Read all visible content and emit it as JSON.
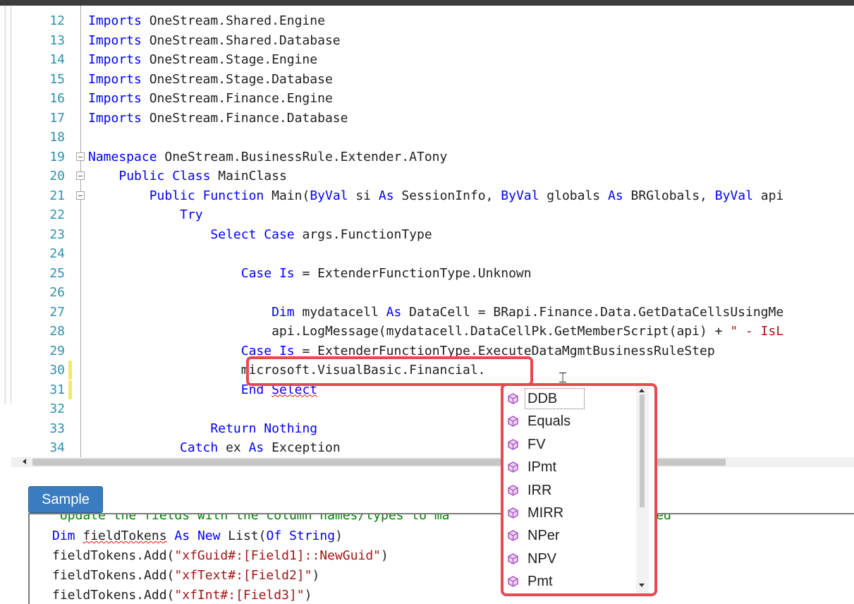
{
  "editor": {
    "lines": [
      {
        "num": "12",
        "tokens": [
          {
            "t": "Imports",
            "k": "kw"
          },
          {
            "t": " OneStream.Shared.Engine"
          }
        ]
      },
      {
        "num": "13",
        "tokens": [
          {
            "t": "Imports",
            "k": "kw"
          },
          {
            "t": " OneStream.Shared.Database"
          }
        ]
      },
      {
        "num": "14",
        "tokens": [
          {
            "t": "Imports",
            "k": "kw"
          },
          {
            "t": " OneStream.Stage.Engine"
          }
        ]
      },
      {
        "num": "15",
        "tokens": [
          {
            "t": "Imports",
            "k": "kw"
          },
          {
            "t": " OneStream.Stage.Database"
          }
        ]
      },
      {
        "num": "16",
        "tokens": [
          {
            "t": "Imports",
            "k": "kw"
          },
          {
            "t": " OneStream.Finance.Engine"
          }
        ]
      },
      {
        "num": "17",
        "tokens": [
          {
            "t": "Imports",
            "k": "kw"
          },
          {
            "t": " OneStream.Finance.Database"
          }
        ]
      },
      {
        "num": "18",
        "tokens": []
      },
      {
        "num": "19",
        "fold": true,
        "tokens": [
          {
            "t": "Namespace",
            "k": "kw"
          },
          {
            "t": " OneStream.BusinessRule.Extender.ATony"
          }
        ]
      },
      {
        "num": "20",
        "fold": true,
        "tokens": [
          {
            "t": "    "
          },
          {
            "t": "Public",
            "k": "kw"
          },
          {
            "t": " "
          },
          {
            "t": "Class",
            "k": "kw"
          },
          {
            "t": " MainClass"
          }
        ]
      },
      {
        "num": "21",
        "fold": true,
        "tokens": [
          {
            "t": "        "
          },
          {
            "t": "Public",
            "k": "kw"
          },
          {
            "t": " "
          },
          {
            "t": "Function",
            "k": "kw"
          },
          {
            "t": " Main("
          },
          {
            "t": "ByVal",
            "k": "kw"
          },
          {
            "t": " si "
          },
          {
            "t": "As",
            "k": "kw"
          },
          {
            "t": " SessionInfo, "
          },
          {
            "t": "ByVal",
            "k": "kw"
          },
          {
            "t": " globals "
          },
          {
            "t": "As",
            "k": "kw"
          },
          {
            "t": " BRGlobals, "
          },
          {
            "t": "ByVal",
            "k": "kw"
          },
          {
            "t": " api"
          }
        ]
      },
      {
        "num": "22",
        "tokens": [
          {
            "t": "            "
          },
          {
            "t": "Try",
            "k": "kw"
          }
        ]
      },
      {
        "num": "23",
        "tokens": [
          {
            "t": "                "
          },
          {
            "t": "Select",
            "k": "kw"
          },
          {
            "t": " "
          },
          {
            "t": "Case",
            "k": "kw"
          },
          {
            "t": " args.FunctionType"
          }
        ]
      },
      {
        "num": "24",
        "tokens": []
      },
      {
        "num": "25",
        "tokens": [
          {
            "t": "                    "
          },
          {
            "t": "Case",
            "k": "kw"
          },
          {
            "t": " "
          },
          {
            "t": "Is",
            "k": "kw"
          },
          {
            "t": " = ExtenderFunctionType.Unknown"
          }
        ]
      },
      {
        "num": "26",
        "tokens": []
      },
      {
        "num": "27",
        "tokens": [
          {
            "t": "                        "
          },
          {
            "t": "Dim",
            "k": "kw"
          },
          {
            "t": " mydatacell "
          },
          {
            "t": "As",
            "k": "kw"
          },
          {
            "t": " DataCell = BRapi.Finance.Data.GetDataCellsUsingMe"
          }
        ]
      },
      {
        "num": "28",
        "tokens": [
          {
            "t": "                        api.LogMessage(mydatacell.DataCellPk.GetMemberScript(api) + "
          },
          {
            "t": "\" - IsL",
            "k": "str"
          }
        ]
      },
      {
        "num": "29",
        "tokens": [
          {
            "t": "                    "
          },
          {
            "t": "Case",
            "k": "kw"
          },
          {
            "t": " "
          },
          {
            "t": "Is",
            "k": "kw"
          },
          {
            "t": " = ExtenderFunctionType.ExecuteDataMgmtBusinessRuleStep"
          }
        ]
      },
      {
        "num": "30",
        "changed": true,
        "tokens": [
          {
            "t": "                    microsoft.VisualBasic.Financial."
          }
        ]
      },
      {
        "num": "31",
        "changed": true,
        "tokens": [
          {
            "t": "                    "
          },
          {
            "t": "End",
            "k": "kw"
          },
          {
            "t": " "
          },
          {
            "t": "Select",
            "k": "kw sq"
          }
        ]
      },
      {
        "num": "32",
        "tokens": []
      },
      {
        "num": "33",
        "tokens": [
          {
            "t": "                "
          },
          {
            "t": "Return",
            "k": "kw"
          },
          {
            "t": " "
          },
          {
            "t": "Nothing",
            "k": "kw"
          }
        ]
      },
      {
        "num": "34",
        "tokens": [
          {
            "t": "            "
          },
          {
            "t": "Catch",
            "k": "kw"
          },
          {
            "t": " ex "
          },
          {
            "t": "As",
            "k": "kw"
          },
          {
            "t": " Exception"
          }
        ]
      }
    ]
  },
  "autocomplete": {
    "items": [
      "DDB",
      "Equals",
      "FV",
      "IPmt",
      "IRR",
      "MIRR",
      "NPer",
      "NPV",
      "Pmt"
    ],
    "selected": "DDB",
    "icon": "method-cube-icon",
    "icon_color": "#a64dbd"
  },
  "sample_button": {
    "label": "Sample"
  },
  "bottom_panel": {
    "lines": [
      {
        "tokens": [
          {
            "t": "'Update the fields with the column names/types to ma",
            "k": "cm"
          },
          {
            "t": "                     "
          },
          {
            "t": "e loaded",
            "k": "cm"
          }
        ]
      },
      {
        "tokens": [
          {
            "t": "Dim",
            "k": "kw"
          },
          {
            "t": " "
          },
          {
            "t": "fieldTokens",
            "k": "sq"
          },
          {
            "t": " "
          },
          {
            "t": "As",
            "k": "kw"
          },
          {
            "t": " "
          },
          {
            "t": "New",
            "k": "kw"
          },
          {
            "t": " List("
          },
          {
            "t": "Of",
            "k": "kw"
          },
          {
            "t": " "
          },
          {
            "t": "String",
            "k": "kw"
          },
          {
            "t": ")"
          }
        ]
      },
      {
        "tokens": [
          {
            "t": "fieldTokens.Add("
          },
          {
            "t": "\"xfGuid#:[Field1]::NewGuid\"",
            "k": "str"
          },
          {
            "t": ")"
          }
        ]
      },
      {
        "tokens": [
          {
            "t": "fieldTokens.Add("
          },
          {
            "t": "\"xfText#:[Field2]\"",
            "k": "str"
          },
          {
            "t": ")"
          }
        ]
      },
      {
        "tokens": [
          {
            "t": "fieldTokens.Add("
          },
          {
            "t": "\"xfInt#:[Field3]\"",
            "k": "str"
          },
          {
            "t": ")"
          }
        ]
      }
    ]
  },
  "colors": {
    "keyword": "#0000ff",
    "string": "#a31515",
    "comment": "#008000",
    "line_number": "#2b91af",
    "highlight_box": "#e8484f",
    "sample_button": "#3a7cc0",
    "change_marker": "#f3e96b"
  }
}
